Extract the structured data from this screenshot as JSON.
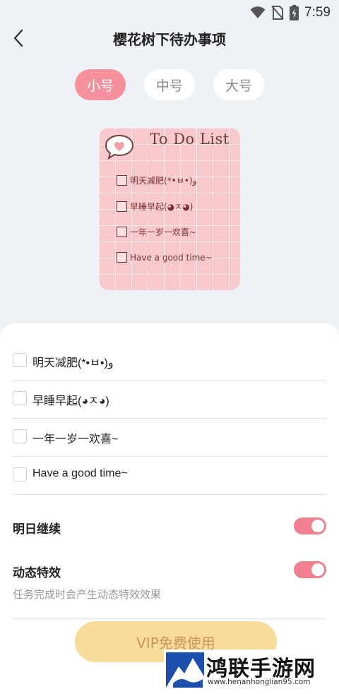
{
  "status_bar": {
    "time": "7:59"
  },
  "header": {
    "title": "樱花树下待办事项"
  },
  "size_tabs": [
    {
      "label": "小号",
      "active": true
    },
    {
      "label": "中号",
      "active": false
    },
    {
      "label": "大号",
      "active": false
    }
  ],
  "preview": {
    "title": "To Do List",
    "items": [
      "明天减肥(*•ㅂ•)و",
      "早睡早起(◕ㅈ◕)",
      "一年一岁一欢喜~",
      "Have a good time~"
    ]
  },
  "tasks": [
    {
      "text": "明天减肥(*•ㅂ•)و",
      "checked": false
    },
    {
      "text": "早睡早起(◕ㅈ◕)",
      "checked": false
    },
    {
      "text": "一年一岁一欢喜~",
      "checked": false
    },
    {
      "text": "Have a good time~",
      "checked": false
    }
  ],
  "settings": {
    "continue_tomorrow": {
      "label": "明日继续",
      "enabled": true
    },
    "dynamic_effects": {
      "label": "动态特效",
      "enabled": true,
      "description": "任务完成时会产生动态特效效果"
    }
  },
  "vip_button": {
    "label": "VIP免费使用"
  },
  "watermark": {
    "name": "鸿联手游网",
    "url": "www.henanhonglian95.com"
  },
  "colors": {
    "accent": "#f4919d",
    "toggle": "#f07f8f",
    "vip": "#f9dc9b",
    "preview_bg": "#f8c9cc"
  }
}
